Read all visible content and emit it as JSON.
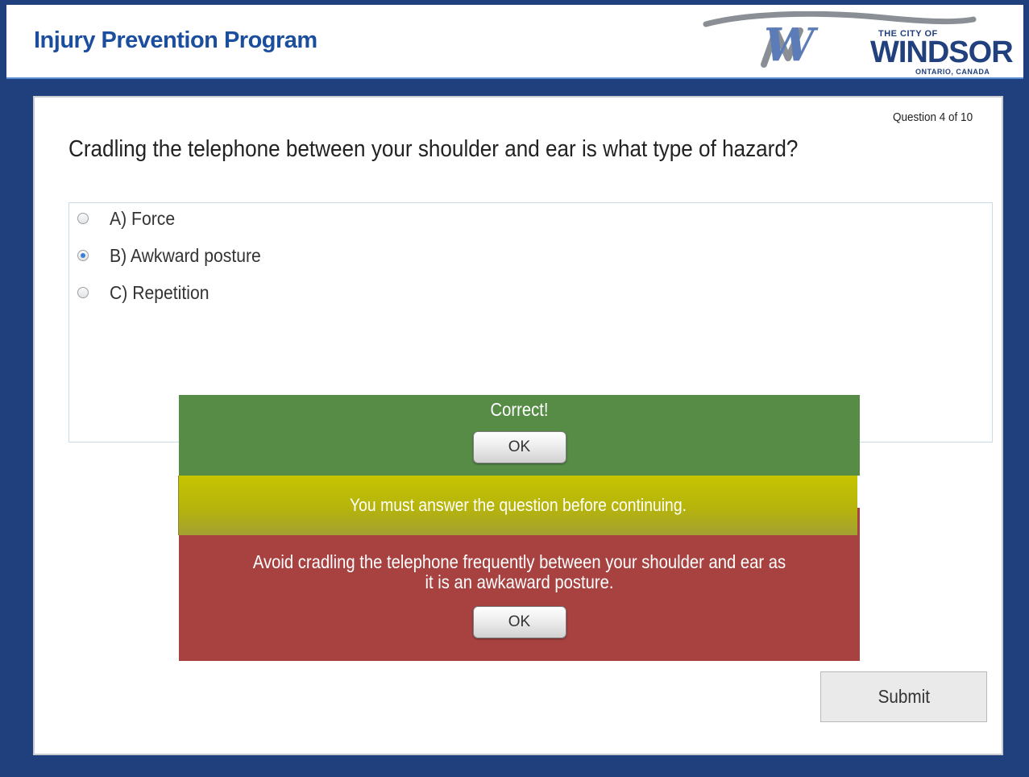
{
  "header": {
    "title": "Injury Prevention Program",
    "logo": {
      "top_text": "THE CITY OF",
      "main_text": "WINDSOR",
      "sub_text": "ONTARIO, CANADA"
    }
  },
  "quiz": {
    "counter": "Question 4 of 10",
    "question": "Cradling the telephone between your shoulder and ear is what type of hazard?",
    "answers": [
      {
        "label": "A) Force",
        "selected": false
      },
      {
        "label": "B) Awkward posture",
        "selected": true
      },
      {
        "label": "C) Repetition",
        "selected": false
      }
    ],
    "submit_label": "Submit"
  },
  "feedback": {
    "correct_text": "Correct!",
    "correct_ok": "OK",
    "warning_text": "You must answer the question before continuing.",
    "message_text": "Avoid cradling the telephone frequently between your shoulder and ear as it is an awkaward posture.",
    "message_ok": "OK"
  },
  "colors": {
    "page_background": "#1f3f7d",
    "title_blue": "#1c4e9e",
    "correct_green": "#578c47",
    "warning_yellow": "#b6b40c",
    "feedback_red": "#a74241"
  }
}
